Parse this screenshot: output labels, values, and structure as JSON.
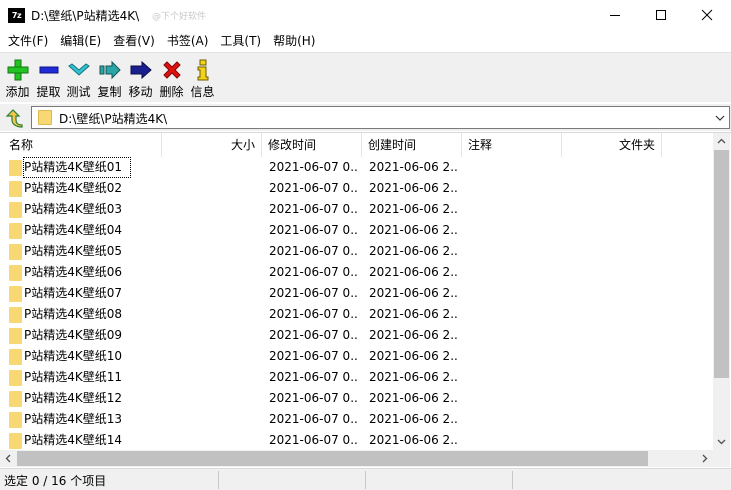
{
  "window": {
    "app_icon_text": "7z",
    "title": "D:\\壁纸\\P站精选4K\\",
    "watermark": "@下个好软件"
  },
  "menu": [
    "文件(F)",
    "编辑(E)",
    "查看(V)",
    "书签(A)",
    "工具(T)",
    "帮助(H)"
  ],
  "toolbar": [
    {
      "label": "添加",
      "icon": "add-plus-icon",
      "color": "#22c322"
    },
    {
      "label": "提取",
      "icon": "extract-minus-icon",
      "color": "#1f2bd6"
    },
    {
      "label": "测试",
      "icon": "test-check-icon",
      "color": "#2ec4d6"
    },
    {
      "label": "复制",
      "icon": "copy-arrow-icon",
      "color": "#2aa6a6"
    },
    {
      "label": "移动",
      "icon": "move-arrow-icon",
      "color": "#1a1f8f"
    },
    {
      "label": "删除",
      "icon": "delete-x-icon",
      "color": "#e01010"
    },
    {
      "label": "信息",
      "icon": "info-icon",
      "color": "#f2d21a"
    }
  ],
  "address": {
    "path": "D:\\壁纸\\P站精选4K\\"
  },
  "columns": [
    "名称",
    "大小",
    "修改时间",
    "创建时间",
    "注释",
    "文件夹"
  ],
  "rows": [
    {
      "name": "P站精选4K壁纸01",
      "modified": "2021-06-07 0...",
      "created": "2021-06-06 2..."
    },
    {
      "name": "P站精选4K壁纸02",
      "modified": "2021-06-07 0...",
      "created": "2021-06-06 2..."
    },
    {
      "name": "P站精选4K壁纸03",
      "modified": "2021-06-07 0...",
      "created": "2021-06-06 2..."
    },
    {
      "name": "P站精选4K壁纸04",
      "modified": "2021-06-07 0...",
      "created": "2021-06-06 2..."
    },
    {
      "name": "P站精选4K壁纸05",
      "modified": "2021-06-07 0...",
      "created": "2021-06-06 2..."
    },
    {
      "name": "P站精选4K壁纸06",
      "modified": "2021-06-07 0...",
      "created": "2021-06-06 2..."
    },
    {
      "name": "P站精选4K壁纸07",
      "modified": "2021-06-07 0...",
      "created": "2021-06-06 2..."
    },
    {
      "name": "P站精选4K壁纸08",
      "modified": "2021-06-07 0...",
      "created": "2021-06-06 2..."
    },
    {
      "name": "P站精选4K壁纸09",
      "modified": "2021-06-07 0...",
      "created": "2021-06-06 2..."
    },
    {
      "name": "P站精选4K壁纸10",
      "modified": "2021-06-07 0...",
      "created": "2021-06-06 2..."
    },
    {
      "name": "P站精选4K壁纸11",
      "modified": "2021-06-07 0...",
      "created": "2021-06-06 2..."
    },
    {
      "name": "P站精选4K壁纸12",
      "modified": "2021-06-07 0...",
      "created": "2021-06-06 2..."
    },
    {
      "name": "P站精选4K壁纸13",
      "modified": "2021-06-07 0...",
      "created": "2021-06-06 2..."
    },
    {
      "name": "P站精选4K壁纸14",
      "modified": "2021-06-07 0...",
      "created": "2021-06-06 2..."
    }
  ],
  "status": {
    "text": "选定 0 / 16 个项目"
  },
  "colors": {
    "folder": "#f8d775",
    "toolbar_bg": "#f0f0f0"
  }
}
